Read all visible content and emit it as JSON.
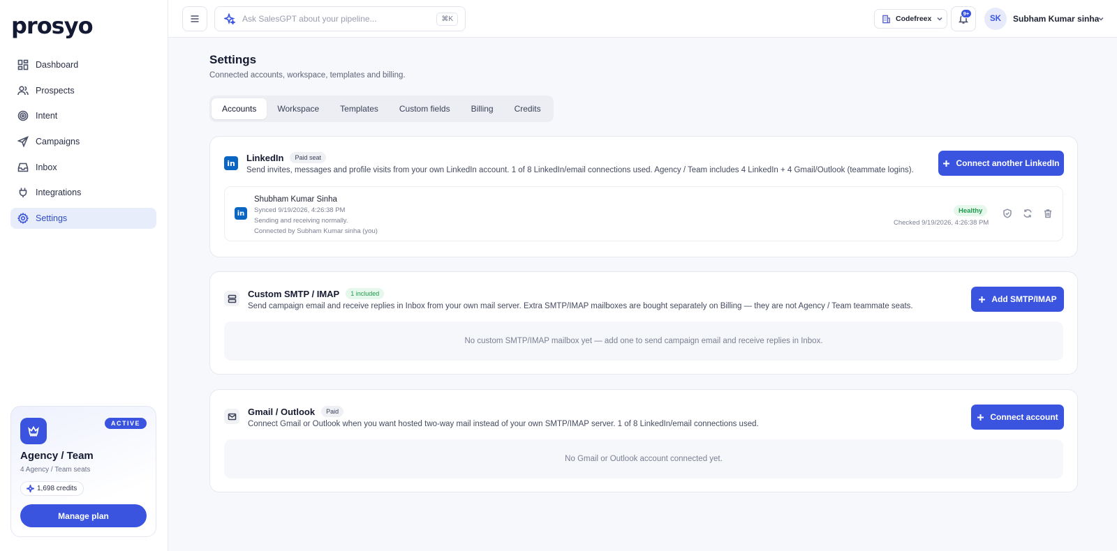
{
  "app": {
    "logo": "prosyo"
  },
  "sidebar": {
    "items": [
      {
        "label": "Dashboard",
        "icon": "dashboard-icon"
      },
      {
        "label": "Prospects",
        "icon": "users-icon"
      },
      {
        "label": "Intent",
        "icon": "target-icon"
      },
      {
        "label": "Campaigns",
        "icon": "send-icon"
      },
      {
        "label": "Inbox",
        "icon": "inbox-icon"
      },
      {
        "label": "Integrations",
        "icon": "plug-icon"
      },
      {
        "label": "Settings",
        "icon": "gear-icon",
        "active": true
      }
    ],
    "plan": {
      "status": "ACTIVE",
      "name": "Agency / Team",
      "seats": "4 Agency / Team seats",
      "credits": "1,698 credits",
      "manage_label": "Manage plan"
    }
  },
  "topbar": {
    "search_placeholder": "Ask SalesGPT about your pipeline...",
    "shortcut": "⌘K",
    "workspace": "Codefreex",
    "notifications": "9+",
    "user_initials": "SK",
    "user_name": "Subham Kumar sinha"
  },
  "page": {
    "title": "Settings",
    "subtitle": "Connected accounts, workspace, templates and billing.",
    "tabs": [
      "Accounts",
      "Workspace",
      "Templates",
      "Custom fields",
      "Billing",
      "Credits"
    ],
    "active_tab": "Accounts"
  },
  "linkedin": {
    "title": "LinkedIn",
    "badge": "Paid seat",
    "description": "Send invites, messages and profile visits from your own LinkedIn account. 1 of 8 LinkedIn/email connections used. Agency / Team includes 4 LinkedIn + 4 Gmail/Outlook (teammate logins).",
    "button": "Connect another LinkedIn",
    "account": {
      "name": "Shubham Kumar Sinha",
      "synced": "Synced 9/19/2026, 4:26:38 PM",
      "status_text": "Sending and receiving normally.",
      "connected_by": "Connected by Subham Kumar sinha (you)",
      "health": "Healthy",
      "checked": "Checked 9/19/2026, 4:26:38 PM"
    }
  },
  "smtp": {
    "title": "Custom SMTP / IMAP",
    "badge": "1 included",
    "description": "Send campaign email and receive replies in Inbox from your own mail server. Extra SMTP/IMAP mailboxes are bought separately on Billing — they are not Agency / Team teammate seats.",
    "button": "Add SMTP/IMAP",
    "empty": "No custom SMTP/IMAP mailbox yet — add one to send campaign email and receive replies in Inbox."
  },
  "gmail": {
    "title": "Gmail / Outlook",
    "badge": "Paid",
    "description": "Connect Gmail or Outlook when you want hosted two-way mail instead of your own SMTP/IMAP server. 1 of 8 LinkedIn/email connections used.",
    "button": "Connect account",
    "empty": "No Gmail or Outlook account connected yet."
  },
  "colors": {
    "accent": "#3a54e0",
    "healthy": "#1f9a4c",
    "linkedin": "#0a66c2"
  }
}
